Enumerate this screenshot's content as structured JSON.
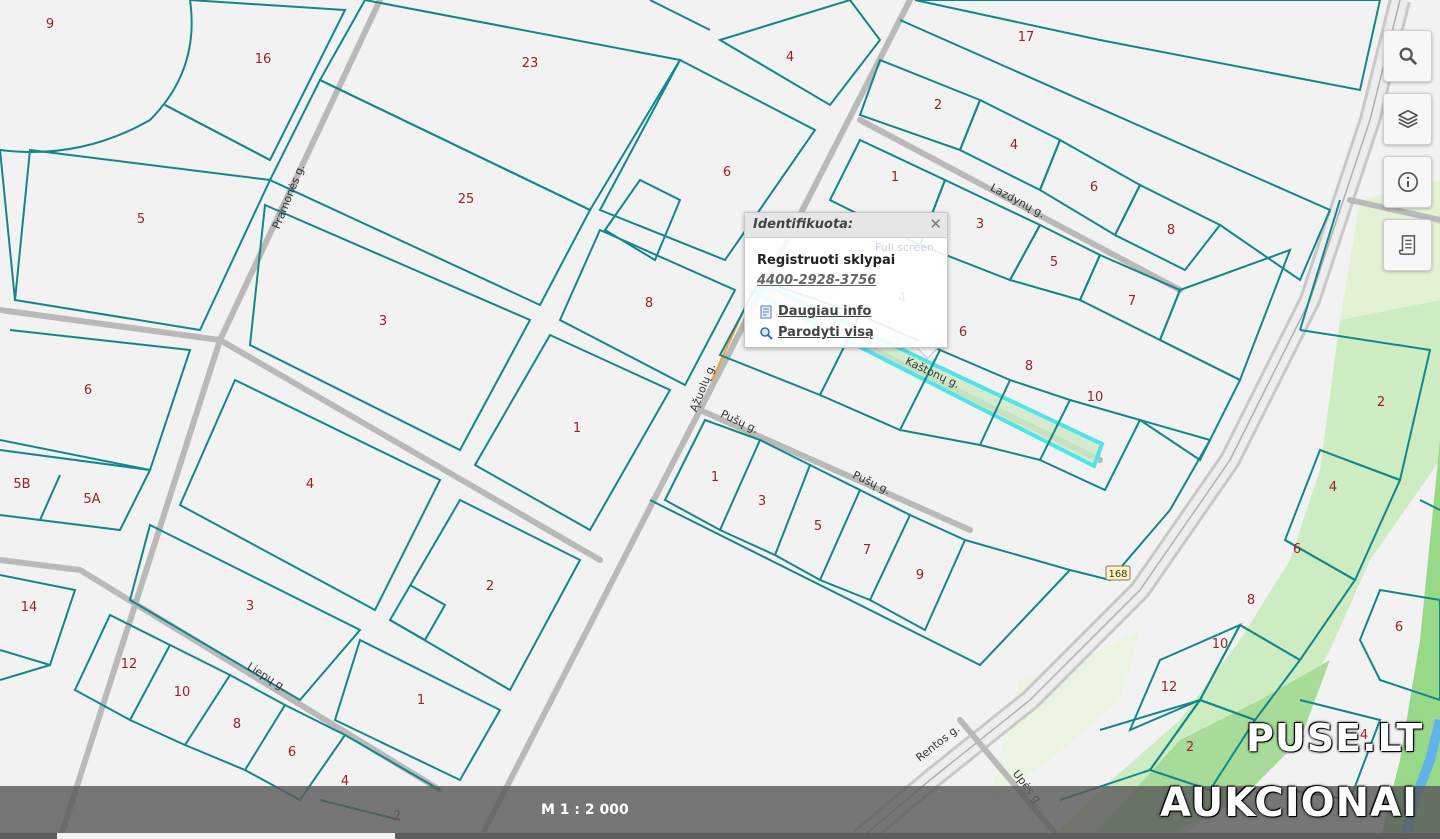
{
  "map": {
    "parcel_numbers": [
      {
        "id": "p-9",
        "label": "9"
      },
      {
        "id": "p-16",
        "label": "16"
      },
      {
        "id": "p-23",
        "label": "23"
      },
      {
        "id": "p-4-top",
        "label": "4"
      },
      {
        "id": "p-17",
        "label": "17"
      },
      {
        "id": "p-5-left",
        "label": "5"
      },
      {
        "id": "p-25",
        "label": "25"
      },
      {
        "id": "p-6-mid",
        "label": "6"
      },
      {
        "id": "p-2-r1",
        "label": "2"
      },
      {
        "id": "p-4-r1",
        "label": "4"
      },
      {
        "id": "p-6-r1",
        "label": "6"
      },
      {
        "id": "p-8-r1",
        "label": "8"
      },
      {
        "id": "p-1-r2",
        "label": "1"
      },
      {
        "id": "p-3-r2",
        "label": "3"
      },
      {
        "id": "p-5-r2",
        "label": "5"
      },
      {
        "id": "p-7-r2",
        "label": "7"
      },
      {
        "id": "p-3-mid",
        "label": "3"
      },
      {
        "id": "p-8-mid",
        "label": "8"
      },
      {
        "id": "p-4-kas",
        "label": "4"
      },
      {
        "id": "p-6-kas",
        "label": "6"
      },
      {
        "id": "p-8-kas",
        "label": "8"
      },
      {
        "id": "p-10-kas",
        "label": "10"
      },
      {
        "id": "p-6-left",
        "label": "6"
      },
      {
        "id": "p-1-mid",
        "label": "1"
      },
      {
        "id": "p-4-left",
        "label": "4"
      },
      {
        "id": "p-5B",
        "label": "5B"
      },
      {
        "id": "p-5A",
        "label": "5A"
      },
      {
        "id": "p-1-pus",
        "label": "1"
      },
      {
        "id": "p-3-pus",
        "label": "3"
      },
      {
        "id": "p-5-pus",
        "label": "5"
      },
      {
        "id": "p-7-pus",
        "label": "7"
      },
      {
        "id": "p-9-pus",
        "label": "9"
      },
      {
        "id": "p-2-right",
        "label": "2"
      },
      {
        "id": "p-4-right",
        "label": "4"
      },
      {
        "id": "p-6-right",
        "label": "6"
      },
      {
        "id": "p-8-right",
        "label": "8"
      },
      {
        "id": "p-10-right",
        "label": "10"
      },
      {
        "id": "p-12-right",
        "label": "12"
      },
      {
        "id": "p-2-right-low",
        "label": "2"
      },
      {
        "id": "p-6-far",
        "label": "6"
      },
      {
        "id": "p-14",
        "label": "14"
      },
      {
        "id": "p-3-low",
        "label": "3"
      },
      {
        "id": "p-2-low",
        "label": "2"
      },
      {
        "id": "p-12-low",
        "label": "12"
      },
      {
        "id": "p-10-low",
        "label": "10"
      },
      {
        "id": "p-8-low",
        "label": "8"
      },
      {
        "id": "p-6-low",
        "label": "6"
      },
      {
        "id": "p-4-low",
        "label": "4"
      },
      {
        "id": "p-1-low",
        "label": "1"
      },
      {
        "id": "p-2-bottom",
        "label": "2"
      },
      {
        "id": "p-4-far",
        "label": "4"
      }
    ],
    "streets": {
      "pramones": "Pramonės g.",
      "lazdynu": "Lazdynų g.",
      "azuolu": "Ąžuolų g.",
      "pusu_1": "Pušų g.",
      "pusu_2": "Pušų g.",
      "kastonu": "Kaštonų g.",
      "liepu": "Liepų g.",
      "rentos": "Rentos g.",
      "upes": "Upės g."
    },
    "road_badge": "168",
    "colors": {
      "parcel_line": "#12878b",
      "parcel_number": "#9b2226",
      "road": "#b5b5b5",
      "highlight": "#4fe3ea",
      "green": "#aee0a1"
    }
  },
  "popup": {
    "title": "Identifikuota:",
    "layer_name": "Registruoti sklypai",
    "parcel_id": "4400-2928-3756",
    "more_info": "Daugiau info",
    "show_all": "Parodyti visą",
    "ghost_text": "Full screen"
  },
  "toolbar": {
    "search": "search-icon",
    "layers": "layers-icon",
    "info": "info-icon",
    "legend": "legend-icon"
  },
  "status": {
    "scale": "M 1 : 2 000"
  },
  "watermark": {
    "line1": "PUSE.LT",
    "line2": "AUKCIONAI"
  }
}
